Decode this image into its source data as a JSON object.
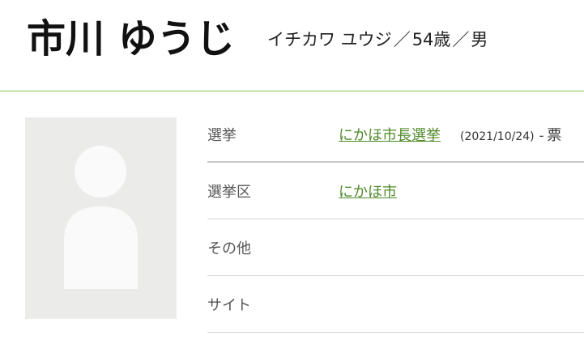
{
  "profile": {
    "name": "市川 ゆうじ",
    "kana": "イチカワ ユウジ",
    "separator": "／",
    "age": "54歳",
    "gender": "男"
  },
  "details": {
    "election": {
      "label": "選挙",
      "value": "にかほ市長選挙",
      "date": "(2021/10/24)",
      "dash": "-",
      "votes_suffix": "票"
    },
    "district": {
      "label": "選挙区",
      "value": "にかほ市"
    },
    "other": {
      "label": "その他",
      "value": ""
    },
    "site": {
      "label": "サイト",
      "value": ""
    }
  },
  "colors": {
    "accent_line": "#8cc152",
    "link": "#4f8a2a",
    "avatar_bg": "#ebebe9"
  },
  "icons": {
    "avatar": "person-placeholder-icon"
  }
}
